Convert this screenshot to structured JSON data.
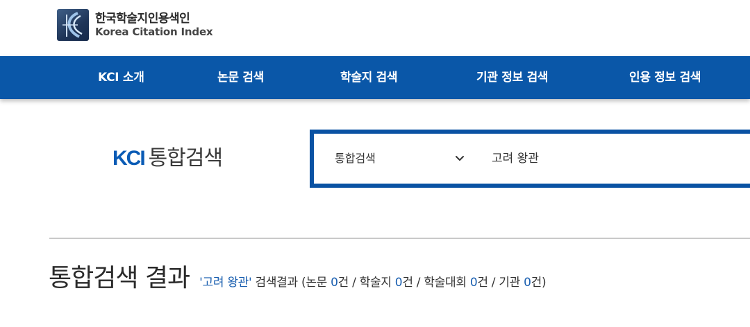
{
  "logo": {
    "korean_name": "한국학술지인용색인",
    "english_name": "Korea Citation Index"
  },
  "nav": {
    "items": [
      {
        "label": "KCI 소개"
      },
      {
        "label": "논문 검색"
      },
      {
        "label": "학술지 검색"
      },
      {
        "label": "기관 정보 검색"
      },
      {
        "label": "인용 정보 검색"
      }
    ]
  },
  "search": {
    "brand": "KCI",
    "title": "통합검색",
    "scope_selected": "통합검색",
    "query": "고려 왕관",
    "chevron_icon": "chevron-down-icon"
  },
  "results": {
    "title": "통합검색 결과",
    "query_quoted": "'고려 왕관'",
    "summary_label": "검색결과",
    "open_paren": "(",
    "papers_label": "논문",
    "papers_count": "0",
    "papers_unit": "건",
    "sep1": "/",
    "journals_label": "학술지",
    "journals_count": "0",
    "journals_unit": "건",
    "sep2": "/",
    "conferences_label": "학술대회",
    "conferences_count": "0",
    "conferences_unit": "건",
    "sep3": "/",
    "institutions_label": "기관",
    "institutions_count": "0",
    "institutions_unit": "건",
    "close_paren": ")"
  },
  "colors": {
    "nav_bg": "#0a57a8",
    "accent": "#1a5fb0",
    "search_border": "#0a52a3"
  }
}
